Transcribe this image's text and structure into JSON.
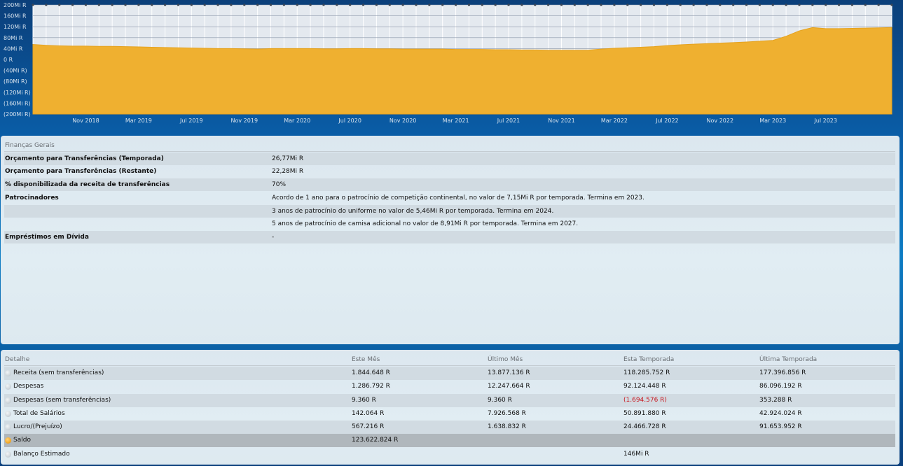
{
  "chart_data": {
    "type": "area",
    "y_ticks": [
      "200Mi R",
      "160Mi R",
      "120Mi R",
      "80Mi R",
      "40Mi R",
      "0 R",
      "(40Mi R)",
      "(80Mi R)",
      "(120Mi R)",
      "(160Mi R)",
      "(200Mi R)"
    ],
    "y_values": [
      200,
      160,
      120,
      80,
      40,
      0,
      -40,
      -80,
      -120,
      -160,
      -200
    ],
    "x_ticks": [
      "Nov 2018",
      "Mar 2019",
      "Jul 2019",
      "Nov 2019",
      "Mar 2020",
      "Jul 2020",
      "Nov 2020",
      "Mar 2021",
      "Jul 2021",
      "Nov 2021",
      "Mar 2022",
      "Jul 2022",
      "Nov 2022",
      "Mar 2023",
      "Jul 2023"
    ],
    "x_tick_index": [
      4,
      8,
      12,
      16,
      20,
      24,
      28,
      32,
      36,
      40,
      44,
      48,
      52,
      56,
      60
    ],
    "ylim": [
      -200,
      200
    ],
    "grid": true,
    "area_color": "#efb030",
    "series": [
      {
        "values": [
          55,
          52,
          50,
          49,
          49,
          48,
          48,
          47,
          46,
          45,
          44,
          43,
          42,
          41,
          40,
          40,
          39,
          38,
          40,
          40,
          40,
          40,
          39,
          39,
          40,
          40,
          39,
          39,
          38,
          38,
          38,
          38,
          37,
          37,
          37,
          36,
          36,
          35,
          35,
          34,
          34,
          34,
          34,
          38,
          41,
          43,
          45,
          47,
          51,
          54,
          56,
          58,
          60,
          62,
          64,
          67,
          70,
          85,
          105,
          117,
          113,
          113,
          114,
          115,
          116,
          117
        ]
      }
    ]
  },
  "finance": {
    "title": "Finanças Gerais",
    "rows": [
      {
        "label": "Orçamento para Transferências (Temporada)",
        "value": "26,77Mi R"
      },
      {
        "label": "Orçamento para Transferências (Restante)",
        "value": "22,28Mi R"
      },
      {
        "label": "% disponibilizada da receita de transferências",
        "value": "70%"
      },
      {
        "label": "Patrocinadores",
        "value": "Acordo de 1 ano para o patrocínio de competição continental, no valor de 7,15Mi R por temporada. Termina em 2023."
      },
      {
        "label": "",
        "value": "3 anos de patrocínio do uniforme no valor de 5,46Mi R por temporada. Termina em 2024."
      },
      {
        "label": "",
        "value": "5 anos de patrocínio de camisa adicional no valor de 8,91Mi R por temporada. Termina em 2027."
      },
      {
        "label": "Empréstimos em Dívida",
        "value": "-"
      }
    ]
  },
  "detail": {
    "headers": [
      "Detalhe",
      "Este Mês",
      "Último Mês",
      "Esta Temporada",
      "Última Temporada"
    ],
    "rows": [
      {
        "label": "Receita (sem transferências)",
        "cells": [
          "1.844.648 R",
          "13.877.136 R",
          "118.285.752 R",
          "177.396.856 R"
        ]
      },
      {
        "label": "Despesas",
        "cells": [
          "1.286.792 R",
          "12.247.664 R",
          "92.124.448 R",
          "86.096.192 R"
        ]
      },
      {
        "label": "Despesas (sem transferências)",
        "cells": [
          "9.360 R",
          "9.360 R",
          "(1.694.576 R)",
          "353.288 R"
        ]
      },
      {
        "label": "Total de Salários",
        "cells": [
          "142.064 R",
          "7.926.568 R",
          "50.891.880 R",
          "42.924.024 R"
        ]
      },
      {
        "label": "Lucro/(Prejuízo)",
        "cells": [
          "567.216 R",
          "1.638.832 R",
          "24.466.728 R",
          "91.653.952 R"
        ]
      },
      {
        "label": "Saldo",
        "cells": [
          "123.622.824 R",
          "",
          "",
          ""
        ]
      },
      {
        "label": "Balanço Estimado",
        "cells": [
          "",
          "",
          "146Mi R",
          ""
        ]
      }
    ],
    "negative_color": "#c8141c",
    "highlight_color": "#b0b7bc"
  }
}
